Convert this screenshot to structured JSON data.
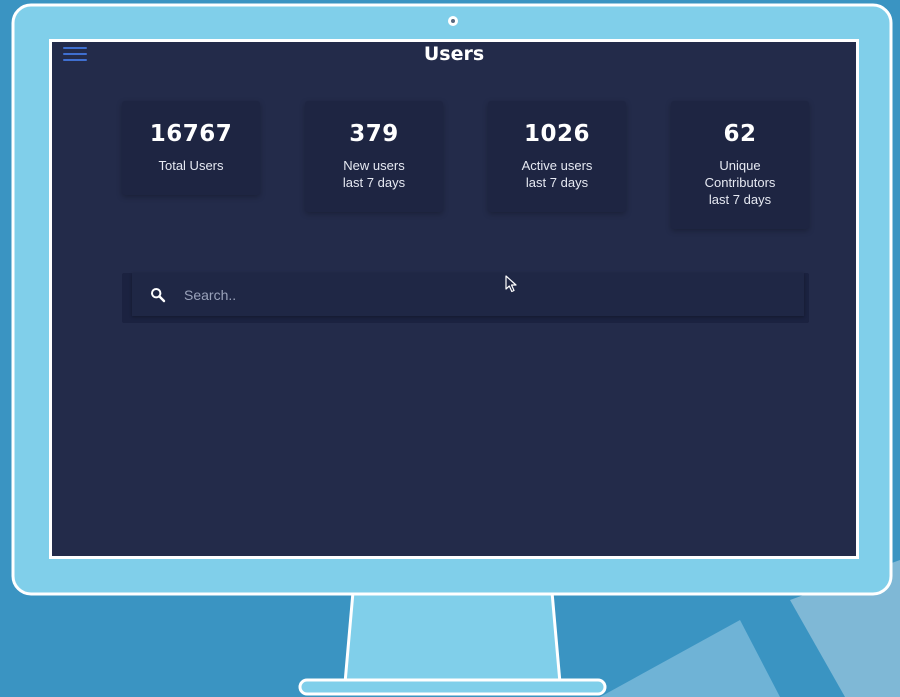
{
  "header": {
    "title": "Users"
  },
  "stats": [
    {
      "value": "16767",
      "label": "Total Users"
    },
    {
      "value": "379",
      "label": "New users\nlast 7 days"
    },
    {
      "value": "1026",
      "label": "Active users\nlast 7 days"
    },
    {
      "value": "62",
      "label": "Unique\nContributors\nlast 7 days"
    }
  ],
  "search": {
    "placeholder": "Search..",
    "value": ""
  },
  "icons": {
    "menu": "hamburger-menu-icon",
    "search": "search-icon",
    "cursor": "mouse-pointer-icon",
    "camera": "webcam-icon"
  },
  "colors": {
    "background": "#3a94c2",
    "monitor_frame": "#80cfea",
    "screen": "#232b4a",
    "card": "#1e2542",
    "menu_accent": "#3f6fd0",
    "text": "#ffffff"
  }
}
